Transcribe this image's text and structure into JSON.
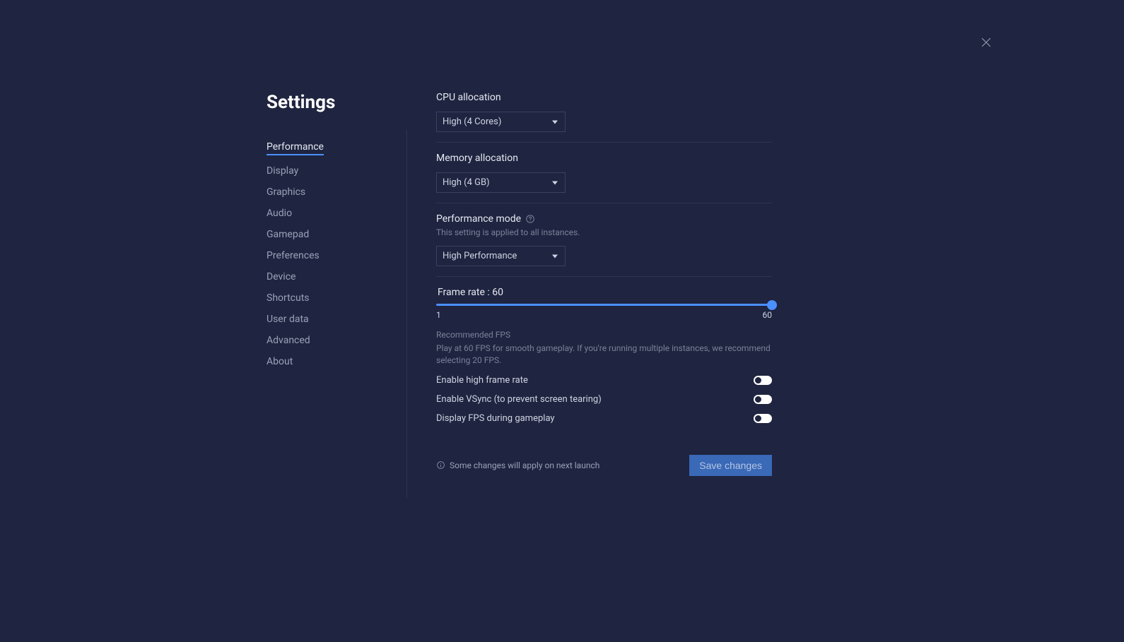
{
  "header": {
    "title": "Settings"
  },
  "sidebar": {
    "items": [
      {
        "label": "Performance",
        "active": true
      },
      {
        "label": "Display"
      },
      {
        "label": "Graphics"
      },
      {
        "label": "Audio"
      },
      {
        "label": "Gamepad"
      },
      {
        "label": "Preferences"
      },
      {
        "label": "Device"
      },
      {
        "label": "Shortcuts"
      },
      {
        "label": "User data"
      },
      {
        "label": "Advanced"
      },
      {
        "label": "About"
      }
    ]
  },
  "cpu": {
    "label": "CPU allocation",
    "value": "High (4 Cores)"
  },
  "memory": {
    "label": "Memory allocation",
    "value": "High (4 GB)"
  },
  "perfmode": {
    "label": "Performance mode",
    "hint": "This setting is applied to all instances.",
    "value": "High Performance"
  },
  "framerate": {
    "label": "Frame rate : 60",
    "min": "1",
    "max": "60",
    "rec_title": "Recommended FPS",
    "rec_text": "Play at 60 FPS for smooth gameplay. If you're running multiple instances, we recommend selecting 20 FPS."
  },
  "toggles": {
    "high_fps": "Enable high frame rate",
    "vsync": "Enable VSync (to prevent screen tearing)",
    "show_fps": "Display FPS during gameplay"
  },
  "footer": {
    "note": "Some changes will apply on next launch",
    "save": "Save changes"
  }
}
